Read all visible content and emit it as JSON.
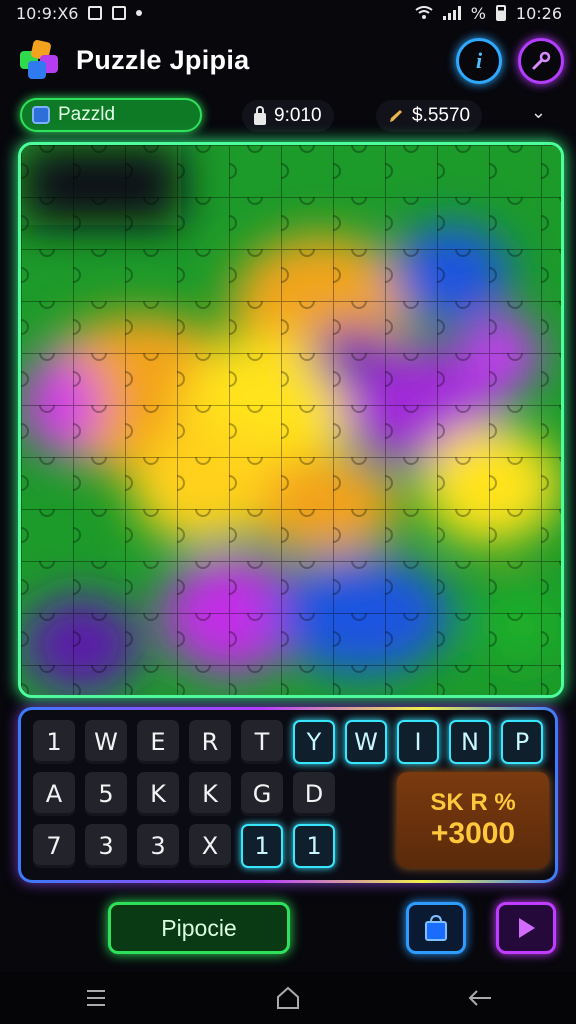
{
  "status_bar": {
    "time_left": "10:9:X6",
    "percent": "%",
    "time_right": "10:26"
  },
  "header": {
    "title": "Puzzle Jpipia",
    "info_icon": "info-icon",
    "settings_icon": "wrench-icon"
  },
  "info_bar": {
    "mode_label": "Pazzld",
    "timer_value": "9:010",
    "score_value": "$.5570"
  },
  "board": {
    "description_colors": [
      "#1fb02a",
      "#f3a21a",
      "#ffe31f",
      "#1f55e0",
      "#c12ee6",
      "#6a1fb0"
    ]
  },
  "keyboard": {
    "row1": [
      "1",
      "W",
      "E",
      "R",
      "T",
      "Y",
      "W",
      "I",
      "N",
      "P"
    ],
    "row2": [
      "A",
      "5",
      "K",
      "K",
      "G",
      "D"
    ],
    "row3": [
      "7",
      "3",
      "3",
      "X",
      "1",
      "1"
    ],
    "score_label": "SK R %",
    "score_value": "+3000"
  },
  "actions": {
    "place_label": "Pipocie"
  },
  "colors": {
    "accent_green": "#2fe05a",
    "accent_cyan": "#39e6ff",
    "accent_purple": "#c13cff",
    "accent_gold": "#ffc83a"
  }
}
